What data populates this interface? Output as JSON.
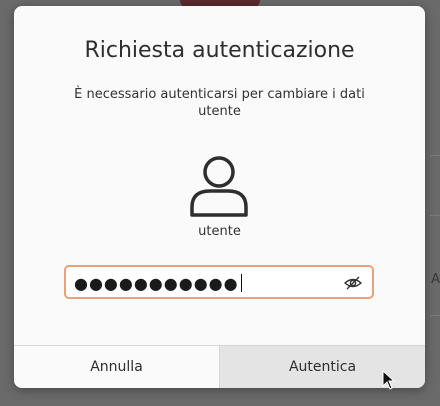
{
  "dialog": {
    "title": "Richiesta autenticazione",
    "message": "È necessario autenticarsi per cambiare i dati utente",
    "username": "utente",
    "password": {
      "masked_value": "●●●●●●●●●●●",
      "reveal_icon": "eye-slash-icon"
    },
    "buttons": {
      "cancel_label": "Annulla",
      "authenticate_label": "Autentica"
    }
  },
  "background": {
    "edge_text": "A"
  },
  "colors": {
    "focus_border": "#e9a177",
    "dialog_bg": "#fafafa",
    "default_button_bg": "#e4e4e4"
  }
}
